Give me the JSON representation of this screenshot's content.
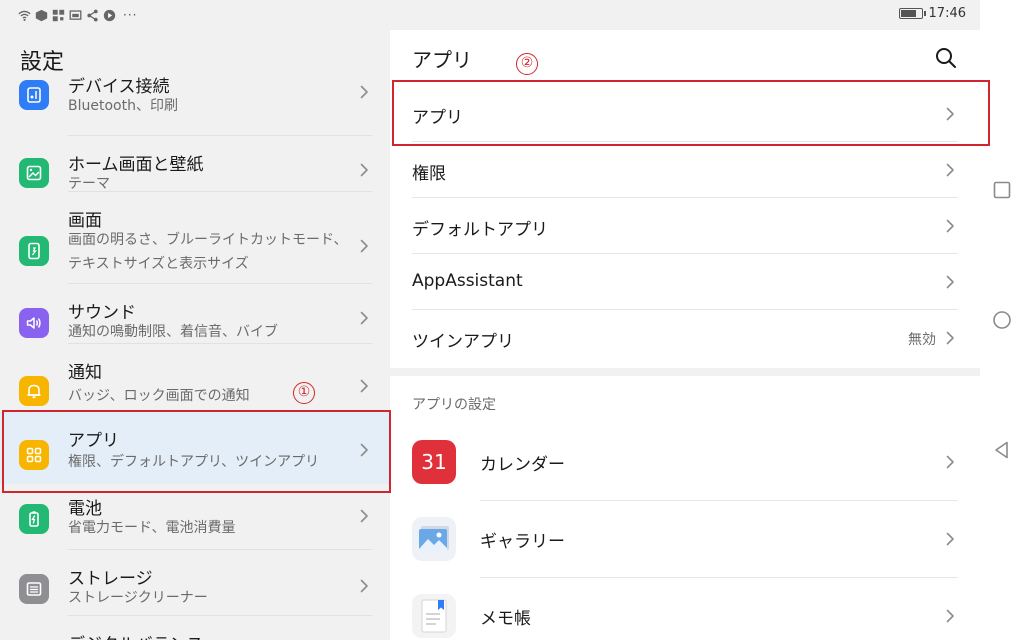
{
  "status_bar": {
    "time": "17:46",
    "more": "···",
    "battery_level": 0.85
  },
  "left_pane": {
    "title": "設定",
    "items": [
      {
        "title": "デバイス接続",
        "subtitle": "Bluetooth、印刷",
        "icon": "device-connection-icon",
        "color": "#2e7cf6"
      },
      {
        "title": "ホーム画面と壁紙",
        "subtitle": "テーマ",
        "icon": "wallpaper-icon",
        "color": "#23b873"
      },
      {
        "title": "画面",
        "subtitle": "画面の明るさ、ブルーライトカットモード、テキストサイズと表示サイズ",
        "icon": "display-icon",
        "color": "#23b873"
      },
      {
        "title": "サウンド",
        "subtitle": "通知の鳴動制限、着信音、バイブ",
        "icon": "sound-icon",
        "color": "#8a62f0"
      },
      {
        "title": "通知",
        "subtitle": "バッジ、ロック画面での通知",
        "icon": "notification-bell-icon",
        "color": "#f7b500"
      },
      {
        "title": "アプリ",
        "subtitle": "権限、デフォルトアプリ、ツインアプリ",
        "icon": "apps-grid-icon",
        "color": "#f7b500"
      },
      {
        "title": "電池",
        "subtitle": "省電力モード、電池消費量",
        "icon": "battery-icon",
        "color": "#23b873"
      },
      {
        "title": "ストレージ",
        "subtitle": "ストレージクリーナー",
        "icon": "storage-icon",
        "color": "#8e8e93"
      },
      {
        "title": "デジタルバランス",
        "subtitle": "",
        "icon": "digital-balance-icon",
        "color": "#23b873"
      }
    ]
  },
  "right_pane": {
    "title": "アプリ",
    "rows": [
      {
        "label": "アプリ",
        "value": ""
      },
      {
        "label": "権限",
        "value": ""
      },
      {
        "label": "デフォルトアプリ",
        "value": ""
      },
      {
        "label": "AppAssistant",
        "value": ""
      },
      {
        "label": "ツインアプリ",
        "value": "無効"
      }
    ],
    "section_label": "アプリの設定",
    "apps": [
      {
        "label": "カレンダー",
        "icon": "calendar-app-icon",
        "icon_text": "31"
      },
      {
        "label": "ギャラリー",
        "icon": "gallery-app-icon",
        "icon_text": ""
      },
      {
        "label": "メモ帳",
        "icon": "notepad-app-icon",
        "icon_text": ""
      }
    ]
  },
  "annotations": {
    "marker_1": "①",
    "marker_2": "②",
    "color": "#d0262e"
  },
  "colors": {
    "selected_bg": "#e3eef8",
    "pane_bg": "#f1f1f1"
  }
}
